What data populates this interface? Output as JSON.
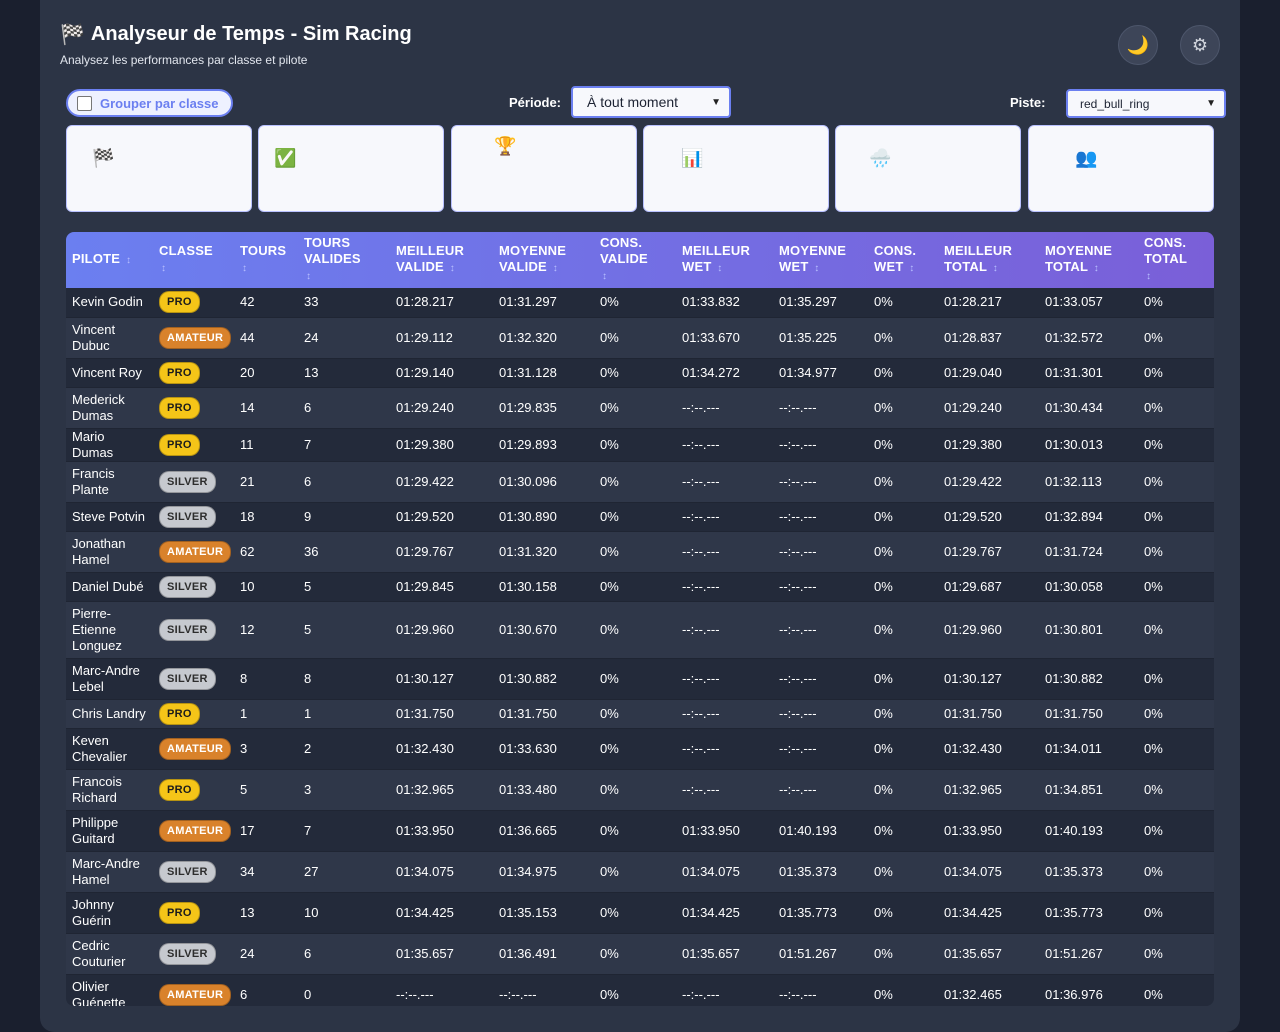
{
  "app": {
    "title": "Analyseur de Temps - Sim Racing",
    "title_icon": "🏁",
    "subtitle": "Analysez les performances par classe et pilote",
    "theme_icon": "🌙",
    "settings_icon": "⚙"
  },
  "controls": {
    "group_label": "Grouper par classe",
    "group_checked": false,
    "period_label": "Période:",
    "period_value": "À tout moment",
    "track_label": "Piste:",
    "track_value": "red_bull_ring"
  },
  "stats": [
    {
      "icon": "🏁",
      "name": "checkered-flag-icon"
    },
    {
      "icon": "✅",
      "name": "check-icon"
    },
    {
      "icon": "🏆",
      "name": "trophy-icon"
    },
    {
      "icon": "📊",
      "name": "chart-icon"
    },
    {
      "icon": "🌧️",
      "name": "rain-icon"
    },
    {
      "icon": "👥",
      "name": "users-icon"
    }
  ],
  "colors": {
    "accent": "#6b7ff0",
    "header_gradient_end": "#7a5fd8",
    "pro": "#f5c518",
    "amateur": "#d9822b",
    "silver": "#c6c9cf"
  },
  "table": {
    "sort_icon": "↕",
    "columns": [
      [
        "Pilote"
      ],
      [
        "Classe"
      ],
      [
        "Tours"
      ],
      [
        "Tours",
        "valides"
      ],
      [
        "Meilleur",
        "valide"
      ],
      [
        "Moyenne",
        "valide"
      ],
      [
        "Cons.",
        "valide"
      ],
      [
        "Meilleur",
        "wet"
      ],
      [
        "Moyenne",
        "wet"
      ],
      [
        "Cons.",
        "wet"
      ],
      [
        "Meilleur",
        "total"
      ],
      [
        "Moyenne",
        "total"
      ],
      [
        "Cons.",
        "total"
      ]
    ],
    "rows": [
      [
        "Kevin Godin",
        "PRO",
        "42",
        "33",
        "01:28.217",
        "01:31.297",
        "0%",
        "01:33.832",
        "01:35.297",
        "0%",
        "01:28.217",
        "01:33.057",
        "0%"
      ],
      [
        "Vincent Dubuc",
        "AMATEUR",
        "44",
        "24",
        "01:29.112",
        "01:32.320",
        "0%",
        "01:33.670",
        "01:35.225",
        "0%",
        "01:28.837",
        "01:32.572",
        "0%"
      ],
      [
        "Vincent Roy",
        "PRO",
        "20",
        "13",
        "01:29.140",
        "01:31.128",
        "0%",
        "01:34.272",
        "01:34.977",
        "0%",
        "01:29.040",
        "01:31.301",
        "0%"
      ],
      [
        "Mederick Dumas",
        "PRO",
        "14",
        "6",
        "01:29.240",
        "01:29.835",
        "0%",
        "--:--.---",
        "--:--.---",
        "0%",
        "01:29.240",
        "01:30.434",
        "0%"
      ],
      [
        "Mario Dumas",
        "PRO",
        "11",
        "7",
        "01:29.380",
        "01:29.893",
        "0%",
        "--:--.---",
        "--:--.---",
        "0%",
        "01:29.380",
        "01:30.013",
        "0%"
      ],
      [
        "Francis Plante",
        "SILVER",
        "21",
        "6",
        "01:29.422",
        "01:30.096",
        "0%",
        "--:--.---",
        "--:--.---",
        "0%",
        "01:29.422",
        "01:32.113",
        "0%"
      ],
      [
        "Steve Potvin",
        "SILVER",
        "18",
        "9",
        "01:29.520",
        "01:30.890",
        "0%",
        "--:--.---",
        "--:--.---",
        "0%",
        "01:29.520",
        "01:32.894",
        "0%"
      ],
      [
        "Jonathan Hamel",
        "AMATEUR",
        "62",
        "36",
        "01:29.767",
        "01:31.320",
        "0%",
        "--:--.---",
        "--:--.---",
        "0%",
        "01:29.767",
        "01:31.724",
        "0%"
      ],
      [
        "Daniel Dubé",
        "SILVER",
        "10",
        "5",
        "01:29.845",
        "01:30.158",
        "0%",
        "--:--.---",
        "--:--.---",
        "0%",
        "01:29.687",
        "01:30.058",
        "0%"
      ],
      [
        "Pierre-Etienne Longuez",
        "SILVER",
        "12",
        "5",
        "01:29.960",
        "01:30.670",
        "0%",
        "--:--.---",
        "--:--.---",
        "0%",
        "01:29.960",
        "01:30.801",
        "0%"
      ],
      [
        "Marc-Andre Lebel",
        "SILVER",
        "8",
        "8",
        "01:30.127",
        "01:30.882",
        "0%",
        "--:--.---",
        "--:--.---",
        "0%",
        "01:30.127",
        "01:30.882",
        "0%"
      ],
      [
        "Chris Landry",
        "PRO",
        "1",
        "1",
        "01:31.750",
        "01:31.750",
        "0%",
        "--:--.---",
        "--:--.---",
        "0%",
        "01:31.750",
        "01:31.750",
        "0%"
      ],
      [
        "Keven Chevalier",
        "AMATEUR",
        "3",
        "2",
        "01:32.430",
        "01:33.630",
        "0%",
        "--:--.---",
        "--:--.---",
        "0%",
        "01:32.430",
        "01:34.011",
        "0%"
      ],
      [
        "Francois Richard",
        "PRO",
        "5",
        "3",
        "01:32.965",
        "01:33.480",
        "0%",
        "--:--.---",
        "--:--.---",
        "0%",
        "01:32.965",
        "01:34.851",
        "0%"
      ],
      [
        "Philippe Guitard",
        "AMATEUR",
        "17",
        "7",
        "01:33.950",
        "01:36.665",
        "0%",
        "01:33.950",
        "01:40.193",
        "0%",
        "01:33.950",
        "01:40.193",
        "0%"
      ],
      [
        "Marc-Andre Hamel",
        "SILVER",
        "34",
        "27",
        "01:34.075",
        "01:34.975",
        "0%",
        "01:34.075",
        "01:35.373",
        "0%",
        "01:34.075",
        "01:35.373",
        "0%"
      ],
      [
        "Johnny Guérin",
        "PRO",
        "13",
        "10",
        "01:34.425",
        "01:35.153",
        "0%",
        "01:34.425",
        "01:35.773",
        "0%",
        "01:34.425",
        "01:35.773",
        "0%"
      ],
      [
        "Cedric Couturier",
        "SILVER",
        "24",
        "6",
        "01:35.657",
        "01:36.491",
        "0%",
        "01:35.657",
        "01:51.267",
        "0%",
        "01:35.657",
        "01:51.267",
        "0%"
      ],
      [
        "Olivier Guénette",
        "AMATEUR",
        "6",
        "0",
        "--:--.---",
        "--:--.---",
        "0%",
        "--:--.---",
        "--:--.---",
        "0%",
        "01:32.465",
        "01:36.976",
        "0%"
      ]
    ]
  }
}
